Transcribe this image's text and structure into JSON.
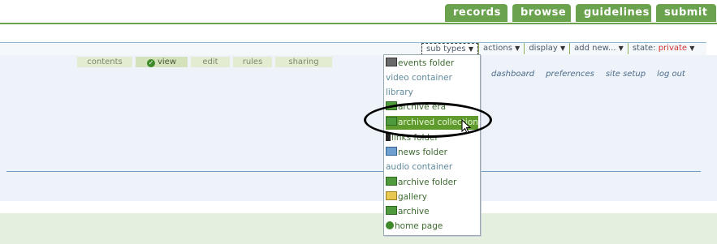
{
  "top_nav": {
    "tabs": [
      {
        "label": "records"
      },
      {
        "label": "browse"
      },
      {
        "label": "guidelines"
      },
      {
        "label": "submit"
      }
    ]
  },
  "action_bar": {
    "sub_types": "sub types",
    "actions": "actions",
    "display": "display",
    "add_new": "add new...",
    "state_label": "state:",
    "state_value": "private"
  },
  "content_tabs": [
    {
      "label": "contents",
      "active": false
    },
    {
      "label": "view",
      "active": true
    },
    {
      "label": "edit",
      "active": false
    },
    {
      "label": "rules",
      "active": false
    },
    {
      "label": "sharing",
      "active": false
    }
  ],
  "personal_links": [
    {
      "label": "dashboard"
    },
    {
      "label": "preferences"
    },
    {
      "label": "site setup"
    },
    {
      "label": "log out"
    }
  ],
  "dropdown": {
    "items": [
      {
        "label": "events folder",
        "icon": "events-folder-icon"
      },
      {
        "label": "video container",
        "icon": ""
      },
      {
        "label": "library",
        "icon": ""
      },
      {
        "label": "archive era",
        "icon": "folder-icon"
      },
      {
        "label": "archived collection",
        "icon": "folder-icon",
        "highlighted": true
      },
      {
        "label": "links folder",
        "icon": "links-icon"
      },
      {
        "label": "news folder",
        "icon": "news-icon"
      },
      {
        "label": "audio container",
        "icon": ""
      },
      {
        "label": "archive folder",
        "icon": "folder-icon"
      },
      {
        "label": "gallery",
        "icon": "gallery-icon"
      },
      {
        "label": "archive",
        "icon": "folder-icon"
      },
      {
        "label": "home page",
        "icon": "home-icon"
      }
    ]
  },
  "colors": {
    "brand_green": "#6aa24d",
    "highlight_green": "#5e9b2c",
    "state_red": "#d03030",
    "content_bg": "#eef3f9"
  }
}
